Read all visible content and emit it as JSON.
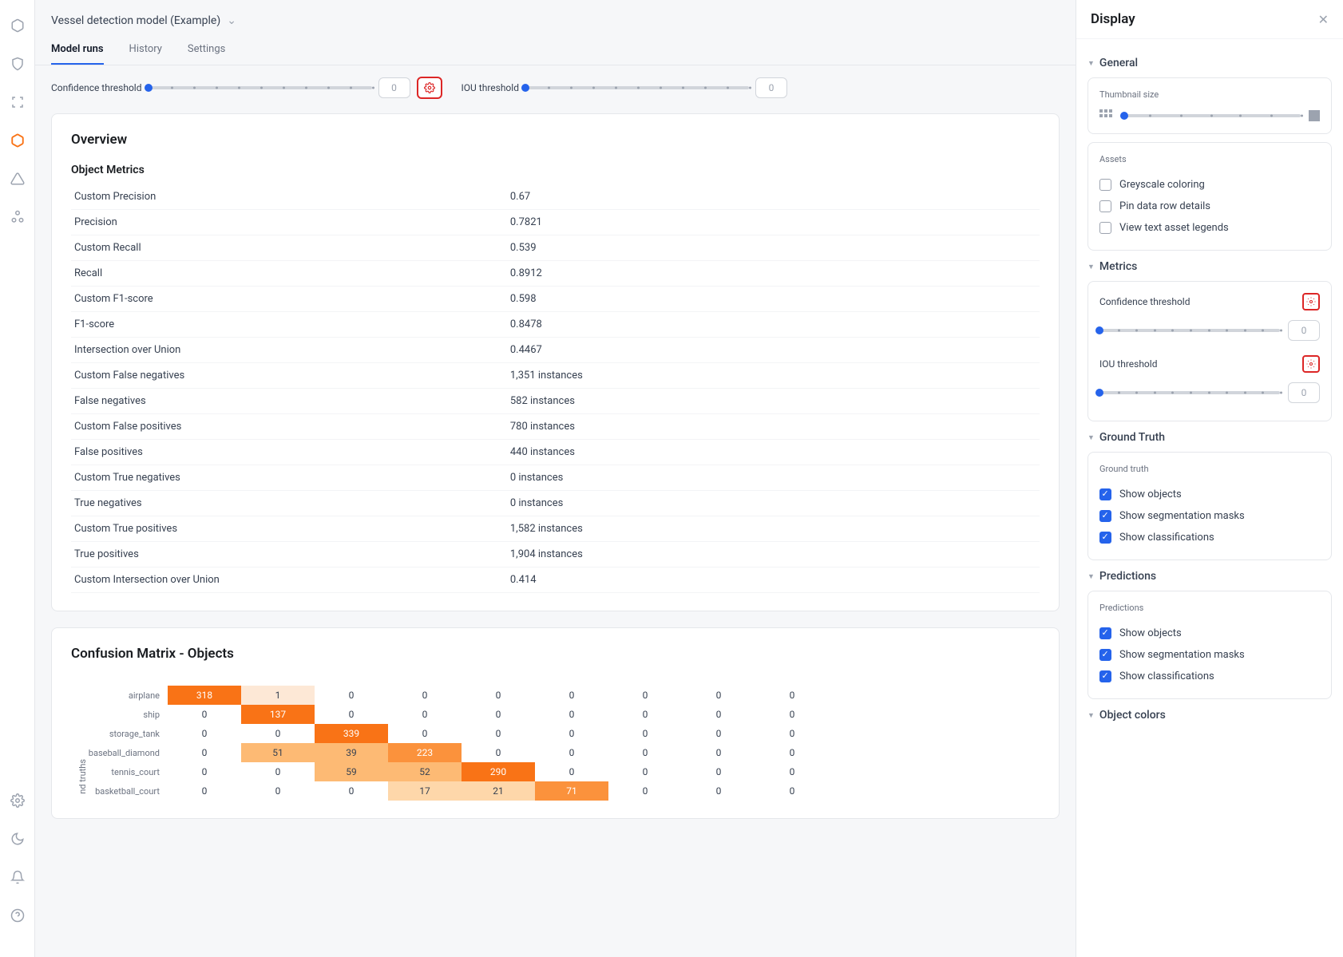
{
  "breadcrumb": {
    "title": "Vessel detection model (Example)"
  },
  "tabs": {
    "model_runs": "Model runs",
    "history": "History",
    "settings": "Settings"
  },
  "thresholds": {
    "confidence_label": "Confidence threshold",
    "confidence_value": "0",
    "iou_label": "IOU threshold",
    "iou_value": "0"
  },
  "overview": {
    "title": "Overview",
    "object_metrics_title": "Object Metrics",
    "rows": [
      {
        "label": "Custom Precision",
        "value": "0.67",
        "link": false
      },
      {
        "label": "Precision",
        "value": "0.7821",
        "link": false
      },
      {
        "label": "Custom Recall",
        "value": "0.539",
        "link": false
      },
      {
        "label": "Recall",
        "value": "0.8912",
        "link": false
      },
      {
        "label": "Custom F1-score",
        "value": "0.598",
        "link": false
      },
      {
        "label": "F1-score",
        "value": "0.8478",
        "link": false
      },
      {
        "label": "Intersection over Union",
        "value": "0.4467",
        "link": false
      },
      {
        "label": "Custom False negatives",
        "value": "1,351 instances",
        "link": true
      },
      {
        "label": "False negatives",
        "value": "582 instances",
        "link": true
      },
      {
        "label": "Custom False positives",
        "value": "780 instances",
        "link": true
      },
      {
        "label": "False positives",
        "value": "440 instances",
        "link": true
      },
      {
        "label": "Custom True negatives",
        "value": "0 instances",
        "link": false
      },
      {
        "label": "True negatives",
        "value": "0 instances",
        "link": false
      },
      {
        "label": "Custom True positives",
        "value": "1,582 instances",
        "link": true
      },
      {
        "label": "True positives",
        "value": "1,904 instances",
        "link": true
      },
      {
        "label": "Custom Intersection over Union",
        "value": "0.414",
        "link": false
      }
    ]
  },
  "confusion": {
    "title": "Confusion Matrix - Objects",
    "axis_label": "nd truths",
    "rows": [
      {
        "label": "airplane",
        "cells": [
          {
            "v": "318",
            "c": "#f97316",
            "t": "#fff"
          },
          {
            "v": "1",
            "c": "#fde8d6"
          },
          {
            "v": "0"
          },
          {
            "v": "0"
          },
          {
            "v": "0"
          },
          {
            "v": "0"
          },
          {
            "v": "0"
          },
          {
            "v": "0"
          },
          {
            "v": "0"
          }
        ]
      },
      {
        "label": "ship",
        "cells": [
          {
            "v": "0"
          },
          {
            "v": "137",
            "c": "#f97316",
            "t": "#fff"
          },
          {
            "v": "0"
          },
          {
            "v": "0"
          },
          {
            "v": "0"
          },
          {
            "v": "0"
          },
          {
            "v": "0"
          },
          {
            "v": "0"
          },
          {
            "v": "0"
          }
        ]
      },
      {
        "label": "storage_tank",
        "cells": [
          {
            "v": "0"
          },
          {
            "v": "0"
          },
          {
            "v": "339",
            "c": "#f97316",
            "t": "#fff"
          },
          {
            "v": "0"
          },
          {
            "v": "0"
          },
          {
            "v": "0"
          },
          {
            "v": "0"
          },
          {
            "v": "0"
          },
          {
            "v": "0"
          }
        ]
      },
      {
        "label": "baseball_diamond",
        "cells": [
          {
            "v": "0"
          },
          {
            "v": "51",
            "c": "#fdba74"
          },
          {
            "v": "39",
            "c": "#fdba74"
          },
          {
            "v": "223",
            "c": "#fb923c",
            "t": "#fff"
          },
          {
            "v": "0"
          },
          {
            "v": "0"
          },
          {
            "v": "0"
          },
          {
            "v": "0"
          },
          {
            "v": "0"
          }
        ]
      },
      {
        "label": "tennis_court",
        "cells": [
          {
            "v": "0"
          },
          {
            "v": "0"
          },
          {
            "v": "59",
            "c": "#fdba74"
          },
          {
            "v": "52",
            "c": "#fdba74"
          },
          {
            "v": "290",
            "c": "#f97316",
            "t": "#fff"
          },
          {
            "v": "0"
          },
          {
            "v": "0"
          },
          {
            "v": "0"
          },
          {
            "v": "0"
          }
        ]
      },
      {
        "label": "basketball_court",
        "cells": [
          {
            "v": "0"
          },
          {
            "v": "0"
          },
          {
            "v": "0"
          },
          {
            "v": "17",
            "c": "#fed7aa"
          },
          {
            "v": "21",
            "c": "#fed7aa"
          },
          {
            "v": "71",
            "c": "#fb923c",
            "t": "#fff"
          },
          {
            "v": "0"
          },
          {
            "v": "0"
          },
          {
            "v": "0"
          }
        ]
      }
    ]
  },
  "sidepanel": {
    "title": "Display",
    "general": {
      "title": "General",
      "thumbnail_size": "Thumbnail size",
      "assets_title": "Assets",
      "greyscale": "Greyscale coloring",
      "pin_row": "Pin data row details",
      "view_legends": "View text asset legends"
    },
    "metrics": {
      "title": "Metrics",
      "confidence_label": "Confidence threshold",
      "confidence_value": "0",
      "iou_label": "IOU threshold",
      "iou_value": "0"
    },
    "ground_truth": {
      "title": "Ground Truth",
      "sub": "Ground truth",
      "show_objects": "Show objects",
      "show_masks": "Show segmentation masks",
      "show_class": "Show classifications"
    },
    "predictions": {
      "title": "Predictions",
      "sub": "Predictions",
      "show_objects": "Show objects",
      "show_masks": "Show segmentation masks",
      "show_class": "Show classifications"
    },
    "object_colors": {
      "title": "Object colors"
    }
  }
}
